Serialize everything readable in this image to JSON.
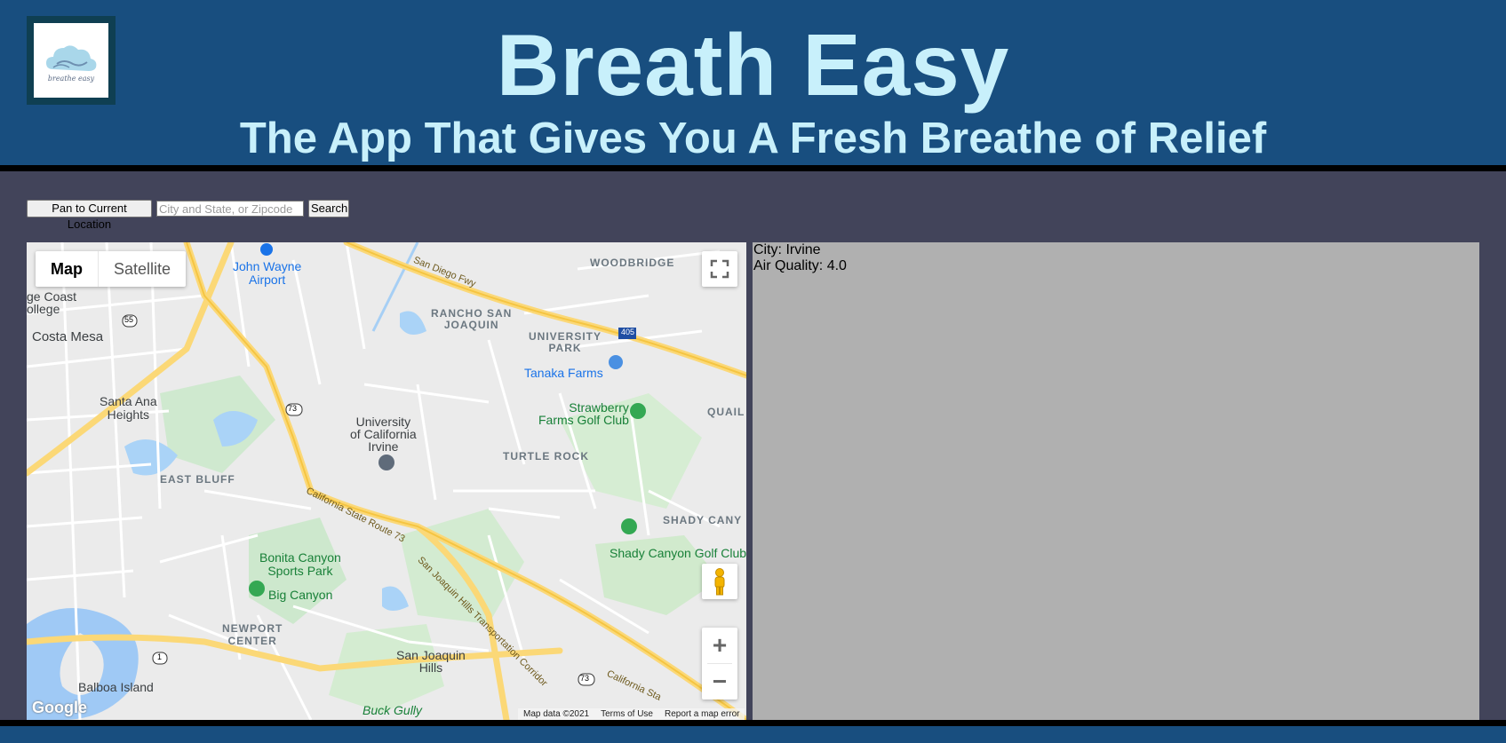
{
  "header": {
    "title": "Breath Easy",
    "subtitle": "The App That Gives You A Fresh Breathe of Relief",
    "logo_text": "breathe easy",
    "bg_color": "#184e7f",
    "text_color": "#c8f0fb"
  },
  "controls": {
    "pan_label": "Pan to Current Location",
    "search_placeholder": "City and State, or Zipcode",
    "search_value": "",
    "search_label": "Search"
  },
  "map": {
    "map_type_active": "Map",
    "map_type_other": "Satellite",
    "fullscreen_icon": "fullscreen-icon",
    "pegman_icon": "pegman-icon",
    "zoom_in": "+",
    "zoom_out": "−",
    "google_logo": "Google",
    "attribution": [
      "Map data ©2021",
      "Terms of Use",
      "Report a map error"
    ],
    "labels": {
      "airport": "John Wayne\nAirport",
      "coast_college": "ge Coast\nollege",
      "costa_mesa": "Costa Mesa",
      "santa_ana_heights": "Santa Ana\nHeights",
      "east_bluff": "EAST BLUFF",
      "newport_center": "NEWPORT\nCENTER",
      "balboa_island": "Balboa Island",
      "buck_gully": "Buck Gully",
      "woodbridge": "WOODBRIDGE",
      "rancho": "RANCHO SAN\nJOAQUIN",
      "university_park": "UNIVERSITY\nPARK",
      "tanaka": "Tanaka Farms",
      "strawberry": "Strawberry\nFarms Golf Club",
      "uci": "University\nof California\nIrvine",
      "turtle_rock": "TURTLE ROCK",
      "quail": "QUAIL",
      "shady_canyon": "SHADY CANY",
      "shady_golf": "Shady Canyon Golf Club",
      "bonita": "Bonita Canyon\nSports Park",
      "big_canyon": "Big Canyon",
      "sj_hills": "San Joaquin\nHills",
      "san_diego_fwy": "San Diego Fwy",
      "ca_73": "California State Route 73",
      "sj_corridor": "San Joaquin Hills Transportation Corridor",
      "ca_sta": "California Sta",
      "i405": "405",
      "r73a": "73",
      "r73b": "73",
      "r55": "55",
      "r1": "1"
    }
  },
  "info": {
    "city_label": "City:",
    "city": "Irvine",
    "aq_label": "Air Quality:",
    "aq": "4.0"
  }
}
